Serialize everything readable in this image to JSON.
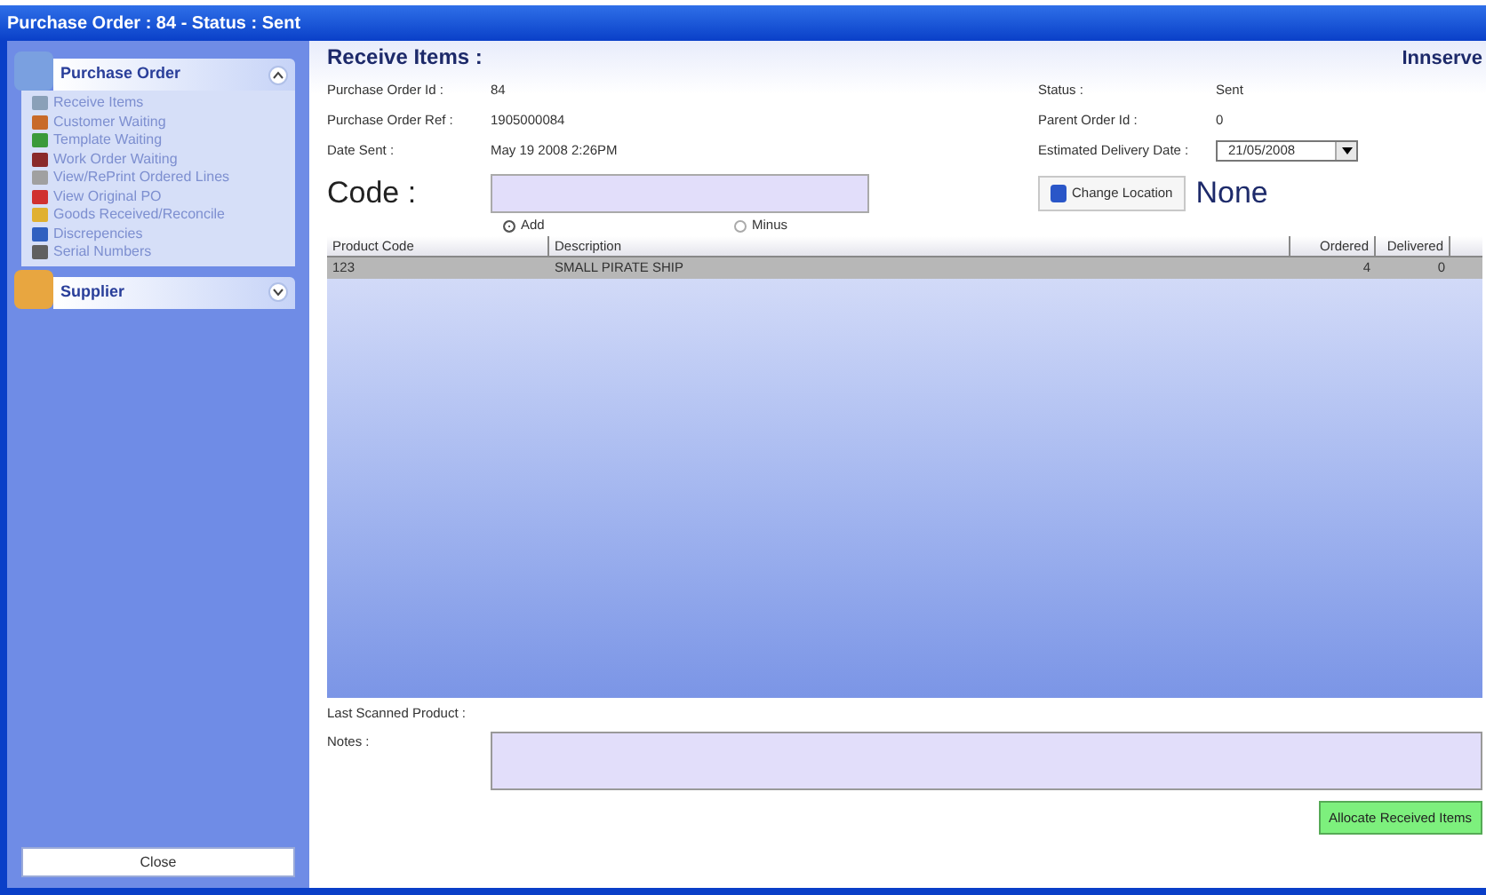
{
  "window": {
    "title": "Purchase Order : 84 - Status : Sent"
  },
  "sidebar": {
    "groups": [
      {
        "title": "Purchase Order",
        "expanded": true,
        "items": [
          {
            "label": "Receive Items"
          },
          {
            "label": "Customer Waiting"
          },
          {
            "label": "Template Waiting"
          },
          {
            "label": "Work Order Waiting"
          },
          {
            "label": "View/RePrint Ordered Lines"
          },
          {
            "label": "View Original PO"
          },
          {
            "label": "Goods Received/Reconcile"
          },
          {
            "label": "Discrepencies"
          },
          {
            "label": "Serial Numbers"
          }
        ]
      },
      {
        "title": "Supplier",
        "expanded": false
      }
    ],
    "close_button": "Close"
  },
  "header": {
    "title": "Receive Items :",
    "brand": "Innserve"
  },
  "fields_left": [
    {
      "label": "Purchase Order Id :",
      "value": "84"
    },
    {
      "label": "Purchase Order Ref :",
      "value": "1905000084"
    },
    {
      "label": "Date Sent :",
      "value": "May 19 2008  2:26PM"
    }
  ],
  "fields_right": [
    {
      "label": "Status :",
      "value": "Sent"
    },
    {
      "label": "Parent Order Id :",
      "value": "0"
    }
  ],
  "delivery_date": {
    "label": "Estimated Delivery Date :",
    "value": "21/05/2008"
  },
  "code": {
    "label": "Code :"
  },
  "change_location": {
    "label": "Change Location",
    "location": "None"
  },
  "mode": [
    {
      "label": "Add",
      "selected": true
    },
    {
      "label": "Minus",
      "selected": false
    }
  ],
  "table": {
    "columns": [
      "Product Code",
      "Description",
      "Ordered",
      "Delivered"
    ],
    "rows": [
      {
        "cells": [
          "123",
          "SMALL PIRATE SHIP",
          "4",
          "0"
        ],
        "selected": true
      }
    ]
  },
  "last_scanned": {
    "label": "Last Scanned Product :"
  },
  "notes": {
    "label": "Notes :"
  },
  "allocate_button": "Allocate Received Items"
}
